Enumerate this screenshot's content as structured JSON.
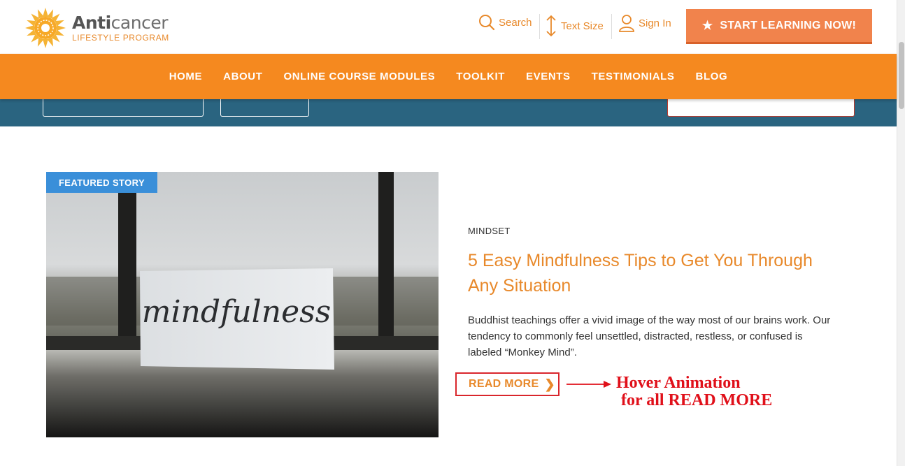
{
  "header": {
    "logo": {
      "title_bold": "Anti",
      "title_rest": "cancer",
      "subtitle": "LIFESTYLE PROGRAM"
    },
    "utilities": {
      "search_label": "Search",
      "text_size_label": "Text Size",
      "sign_in_label": "Sign In"
    },
    "cta_label": "START LEARNING NOW!",
    "icons": [
      "search-icon",
      "text-size-icon",
      "user-icon",
      "star-icon"
    ]
  },
  "nav": {
    "items": [
      "HOME",
      "ABOUT",
      "ONLINE COURSE MODULES",
      "TOOLKIT",
      "EVENTS",
      "TESTIMONIALS",
      "BLOG"
    ]
  },
  "featured": {
    "badge": "FEATURED STORY",
    "category": "MINDSET",
    "title": "5 Easy Mindfulness Tips to Get You Through Any Situation",
    "excerpt": "Buddhist teachings offer a vivid image of the way most of our brains work. Our tendency to commonly feel unsettled, distracted, restless, or confused is labeled “Monkey Mind”.",
    "read_more": "READ MORE",
    "image_text": "mindfulness"
  },
  "annotation": {
    "line1": "Hover Animation",
    "line2": "for all READ MORE"
  },
  "colors": {
    "brand_orange": "#f5891f",
    "cta_orange": "#f1834c",
    "teal": "#2a6480",
    "badge_blue": "#3a8fd9",
    "annotation_red": "#e0101a"
  }
}
